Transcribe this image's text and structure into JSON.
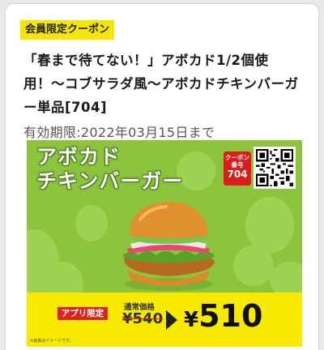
{
  "coupon": {
    "category_badge": "会員限定クーポン",
    "title": "「春まで待てない！」アボカド1/2個使用！〜コブサラダ風〜アボカドチキンバーガー単品[704]",
    "expiry": "有効期限:2022年03月15日まで"
  },
  "banner": {
    "product_name_line1": "アボカド",
    "product_name_line2": "チキンバーガー",
    "coupon_number_label": "クーポン\n番号",
    "coupon_number": "704",
    "app_only_label": "アプリ限定",
    "regular_price_label": "通常価格",
    "regular_price": "¥540",
    "sale_price_yen": "¥",
    "sale_price": "510",
    "image_note": "※画像はイメージです。",
    "colors": {
      "banner_green": "#8cc43e",
      "price_yellow": "#f7ea00",
      "badge_yellow": "#f5e500",
      "app_red": "#e0201f"
    },
    "icons": [
      "qr-code",
      "arrow-right-icon",
      "burger-image"
    ]
  }
}
